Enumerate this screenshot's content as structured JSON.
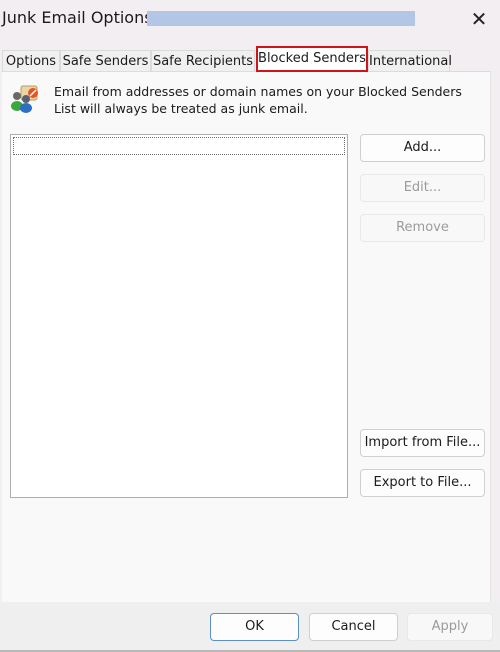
{
  "window": {
    "title": "Junk Email Options -",
    "close_icon": "✕"
  },
  "tabs": [
    {
      "label": "Options",
      "active": false
    },
    {
      "label": "Safe Senders",
      "active": false
    },
    {
      "label": "Safe Recipients",
      "active": false
    },
    {
      "label": "Blocked Senders",
      "active": true
    },
    {
      "label": "International",
      "active": false
    }
  ],
  "panel": {
    "icon": "blocked-senders-icon",
    "description": "Email from addresses or domain names on your Blocked Senders List will always be treated as junk email.",
    "list_items": []
  },
  "side_buttons": {
    "add": {
      "label": "Add...",
      "enabled": true
    },
    "edit": {
      "label": "Edit...",
      "enabled": false
    },
    "remove": {
      "label": "Remove",
      "enabled": false
    },
    "import": {
      "label": "Import from File...",
      "enabled": true
    },
    "export": {
      "label": "Export to File...",
      "enabled": true
    }
  },
  "footer": {
    "ok": {
      "label": "OK",
      "enabled": true
    },
    "cancel": {
      "label": "Cancel",
      "enabled": true
    },
    "apply": {
      "label": "Apply",
      "enabled": false
    }
  },
  "colors": {
    "highlight": "#d0141b",
    "redaction": "#b3c6e6"
  }
}
